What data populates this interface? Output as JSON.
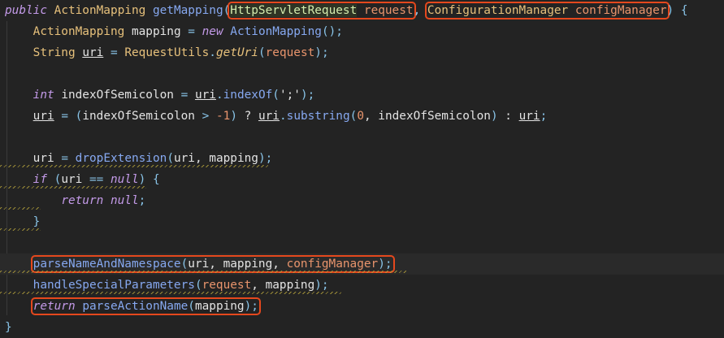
{
  "editor": {
    "language": "java",
    "colors": {
      "background": "#232323",
      "highlight_box": "#e5481d",
      "keyword": "#c39ae8",
      "type": "#e6c07b",
      "method": "#86a8f0",
      "parameter": "#e8946c"
    },
    "current_line": 12,
    "lines": [
      [
        {
          "box": false,
          "t": [
            [
              "public",
              "kw"
            ],
            [
              " ",
              "var"
            ],
            [
              "ActionMapping",
              "type"
            ],
            [
              " ",
              "var"
            ],
            [
              "getMapping",
              "fn"
            ],
            [
              "(",
              "punc"
            ]
          ]
        },
        {
          "box": true,
          "t": [
            [
              "HttpServletRequest",
              "hl"
            ],
            [
              " ",
              "var"
            ],
            [
              "request",
              "param"
            ]
          ]
        },
        {
          "box": false,
          "t": [
            [
              ",",
              "punc"
            ],
            [
              " ",
              "var"
            ]
          ]
        },
        {
          "box": true,
          "t": [
            [
              "ConfigurationManager",
              "type"
            ],
            [
              " ",
              "var"
            ],
            [
              "configManager",
              "param"
            ]
          ]
        },
        {
          "box": false,
          "t": [
            [
              ")",
              "punc"
            ],
            [
              " ",
              "var"
            ],
            [
              "{",
              "punc"
            ]
          ]
        }
      ],
      [
        {
          "box": false,
          "t": [
            [
              "    ",
              "var"
            ],
            [
              "ActionMapping",
              "type"
            ],
            [
              " mapping ",
              "var"
            ],
            [
              "=",
              "punc"
            ],
            [
              " ",
              "var"
            ],
            [
              "new",
              "kw"
            ],
            [
              " ",
              "var"
            ],
            [
              "ActionMapping",
              "fn"
            ],
            [
              "();",
              "punc"
            ]
          ]
        }
      ],
      [
        {
          "box": false,
          "t": [
            [
              "    ",
              "var"
            ],
            [
              "String",
              "type"
            ],
            [
              " ",
              "var"
            ],
            [
              "uri",
              "var ul"
            ],
            [
              " ",
              "var"
            ],
            [
              "=",
              "punc"
            ],
            [
              " ",
              "var"
            ],
            [
              "RequestUtils",
              "type"
            ],
            [
              ".",
              "punc"
            ],
            [
              "getUri",
              "fnit"
            ],
            [
              "(",
              "punc"
            ],
            [
              "request",
              "param"
            ],
            [
              ");",
              "punc"
            ]
          ]
        }
      ],
      [],
      [
        {
          "box": false,
          "t": [
            [
              "    ",
              "var"
            ],
            [
              "int",
              "kw"
            ],
            [
              " indexOfSemicolon ",
              "var"
            ],
            [
              "=",
              "punc"
            ],
            [
              " ",
              "var"
            ],
            [
              "uri",
              "var ul"
            ],
            [
              ".",
              "punc"
            ],
            [
              "indexOf",
              "fn"
            ],
            [
              "(",
              "punc"
            ],
            [
              "';'",
              "var"
            ],
            [
              ");",
              "punc"
            ]
          ]
        }
      ],
      [
        {
          "box": false,
          "t": [
            [
              "    ",
              "var"
            ],
            [
              "uri",
              "var ul"
            ],
            [
              " ",
              "var"
            ],
            [
              "=",
              "punc"
            ],
            [
              " ",
              "var"
            ],
            [
              "(",
              "punc"
            ],
            [
              "indexOfSemicolon ",
              "var"
            ],
            [
              ">",
              "punc"
            ],
            [
              " ",
              "var"
            ],
            [
              "-1",
              "num"
            ],
            [
              ")",
              "punc"
            ],
            [
              " ? ",
              "var"
            ],
            [
              "uri",
              "var ul"
            ],
            [
              ".",
              "punc"
            ],
            [
              "substring",
              "fn"
            ],
            [
              "(",
              "punc"
            ],
            [
              "0",
              "num"
            ],
            [
              ", indexOfSemicolon",
              "var"
            ],
            [
              ")",
              "punc"
            ],
            [
              " : ",
              "var"
            ],
            [
              "uri",
              "var ul"
            ],
            [
              ";",
              "punc"
            ]
          ]
        }
      ],
      [],
      [
        {
          "box": false,
          "t": [
            [
              "    ",
              "var"
            ],
            [
              "uri",
              "var"
            ],
            [
              " ",
              "var"
            ],
            [
              "=",
              "punc"
            ],
            [
              " ",
              "var"
            ],
            [
              "dropExtension",
              "fn"
            ],
            [
              "(",
              "punc"
            ],
            [
              "uri, mapping",
              "var"
            ],
            [
              ");",
              "punc"
            ]
          ]
        }
      ],
      [
        {
          "box": false,
          "t": [
            [
              "    ",
              "var"
            ],
            [
              "if",
              "kw"
            ],
            [
              " ",
              "var"
            ],
            [
              "(",
              "punc"
            ],
            [
              "uri ",
              "var"
            ],
            [
              "==",
              "punc"
            ],
            [
              " ",
              "var"
            ],
            [
              "null",
              "kw"
            ],
            [
              ")",
              "punc"
            ],
            [
              " ",
              "var"
            ],
            [
              "{",
              "punc"
            ]
          ]
        }
      ],
      [
        {
          "box": false,
          "t": [
            [
              "        ",
              "var"
            ],
            [
              "return",
              "kw"
            ],
            [
              " ",
              "var"
            ],
            [
              "null",
              "kw"
            ],
            [
              ";",
              "punc"
            ]
          ]
        }
      ],
      [
        {
          "box": false,
          "t": [
            [
              "    ",
              "var"
            ],
            [
              "}",
              "punc"
            ]
          ]
        }
      ],
      [],
      [
        {
          "box": false,
          "t": [
            [
              "    ",
              "var"
            ]
          ]
        },
        {
          "box": true,
          "t": [
            [
              "parseNameAndNamespace",
              "fn"
            ],
            [
              "(",
              "punc"
            ],
            [
              "uri, mapping, ",
              "var"
            ],
            [
              "configManager",
              "param"
            ],
            [
              ");",
              "punc"
            ]
          ]
        }
      ],
      [
        {
          "box": false,
          "t": [
            [
              "    ",
              "var"
            ],
            [
              "handleSpecialParameters",
              "fn"
            ],
            [
              "(",
              "punc"
            ],
            [
              "request",
              "param"
            ],
            [
              ", mapping",
              "var"
            ],
            [
              ");",
              "punc"
            ]
          ]
        }
      ],
      [
        {
          "box": false,
          "t": [
            [
              "    ",
              "var"
            ]
          ]
        },
        {
          "box": true,
          "t": [
            [
              "return",
              "kw"
            ],
            [
              " ",
              "var"
            ],
            [
              "parseActionName",
              "fn"
            ],
            [
              "(",
              "punc"
            ],
            [
              "mapping",
              "var"
            ],
            [
              ");",
              "punc"
            ]
          ]
        }
      ],
      [
        {
          "box": false,
          "t": [
            [
              "}",
              "punc"
            ]
          ]
        }
      ]
    ],
    "warning_lines": [
      7,
      8,
      9,
      10,
      12,
      13
    ]
  }
}
